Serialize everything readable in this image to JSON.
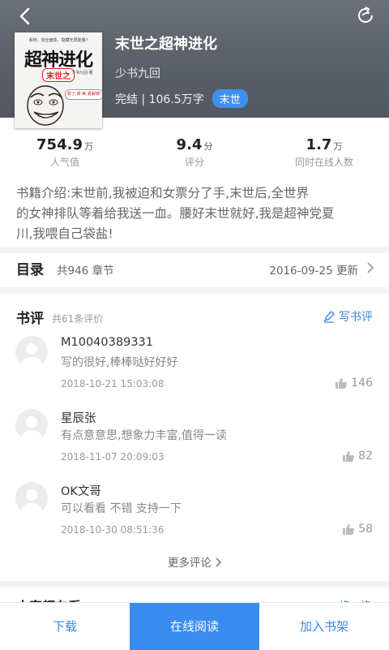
{
  "header": {
    "back_icon": "back-arrow-icon",
    "share_icon": "share-icon",
    "cover_text": {
      "top_line": "系统、完全面体、隐藏无限能量?",
      "title": "超神进化",
      "subtitle": "末世之",
      "author": "少书九回·著",
      "bubble": "看了,真·美,夏解锁!"
    }
  },
  "book": {
    "title": "末世之超神进化",
    "author": "少书九回",
    "status": "完结 | 106.5万字",
    "tag": "末世",
    "tag_color": "#3f8ef2"
  },
  "stats": [
    {
      "num": "754.9",
      "unit": "万",
      "label": "人气值"
    },
    {
      "num": "9.4",
      "unit": "分",
      "label": "评分"
    },
    {
      "num": "1.7",
      "unit": "万",
      "label": "同时在线人数"
    }
  ],
  "intro": {
    "line1": "书籍介绍:末世前,我被迫和女票分了手,末世后,全世界",
    "line2": "的女神排队等着给我送一血。腰好末世就好,我是超神党夏",
    "line3": "川,我喂自己袋盐!"
  },
  "toc": {
    "title": "目录",
    "count": "共946 章节",
    "updated": "2016-09-25 更新"
  },
  "reviews_header": {
    "title": "书评",
    "count": "共61条评价",
    "write": "写书评"
  },
  "reviews": [
    {
      "user": "M10040389331",
      "text": "写的很好,棒棒哒好好好",
      "time": "2018-10-21 15:03:08",
      "likes": "146"
    },
    {
      "user": "星辰张",
      "text": "有点意意思,想象力丰富,值得一读",
      "time": "2018-11-07 20:09:03",
      "likes": "82"
    },
    {
      "user": "OK文哥",
      "text": "可以看看 不错  支持一下",
      "time": "2018-10-30 08:51:36",
      "likes": "58"
    }
  ],
  "more_reviews": "更多评论",
  "next_section": {
    "title": "大家都在看",
    "action": "换一换"
  },
  "bottom_bar": {
    "download": "下载",
    "read_online": "在线阅读",
    "add_shelf": "加入书架",
    "accent": "#3b8cf1"
  }
}
